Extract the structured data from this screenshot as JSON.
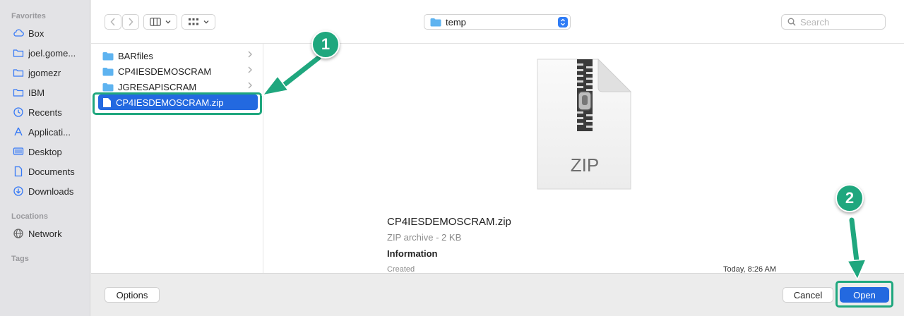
{
  "sidebar": {
    "favorites_header": "Favorites",
    "favorites": [
      {
        "label": "Box",
        "icon": "cloud-icon"
      },
      {
        "label": "joel.gome...",
        "icon": "folder-icon"
      },
      {
        "label": "jgomezr",
        "icon": "folder-icon"
      },
      {
        "label": "IBM",
        "icon": "folder-icon"
      },
      {
        "label": "Recents",
        "icon": "clock-icon"
      },
      {
        "label": "Applicati...",
        "icon": "applications-icon"
      },
      {
        "label": "Desktop",
        "icon": "desktop-icon"
      },
      {
        "label": "Documents",
        "icon": "document-icon"
      },
      {
        "label": "Downloads",
        "icon": "download-icon"
      }
    ],
    "locations_header": "Locations",
    "locations": [
      {
        "label": "Network",
        "icon": "globe-icon"
      }
    ],
    "tags_header": "Tags"
  },
  "toolbar": {
    "path_label": "temp",
    "search_placeholder": "Search"
  },
  "files": [
    {
      "name": "BARfiles",
      "type": "folder"
    },
    {
      "name": "CP4IESDEMOSCRAM",
      "type": "folder"
    },
    {
      "name": "JGRESAPISCRAM",
      "type": "folder"
    },
    {
      "name": "CP4IESDEMOSCRAM.zip",
      "type": "zip",
      "selected": true
    }
  ],
  "preview": {
    "icon_text": "ZIP",
    "name": "CP4IESDEMOSCRAM.zip",
    "kind": "ZIP archive - 2 KB",
    "info_header": "Information",
    "created_label": "Created",
    "created_value": "Today, 8:26 AM"
  },
  "buttons": {
    "options": "Options",
    "cancel": "Cancel",
    "open": "Open"
  },
  "annotations": {
    "step1": "1",
    "step2": "2",
    "color": "#1fa77e"
  },
  "colors": {
    "accent": "#2369e0",
    "folder": "#5eb3f0"
  }
}
